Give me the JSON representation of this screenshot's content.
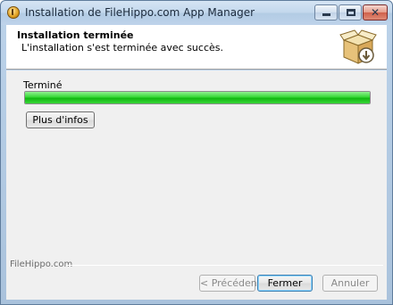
{
  "window": {
    "title": "Installation de FileHippo.com App Manager",
    "close_glyph": "✕"
  },
  "header": {
    "title": "Installation terminée",
    "subtitle": "L'installation s'est terminée avec succès.",
    "icon": "box-install-icon"
  },
  "progress": {
    "label": "Terminé",
    "value": 1.0,
    "color": "#1fc41f"
  },
  "buttons": {
    "more_info": "Plus d'infos",
    "previous": "< Précédent",
    "close": "Fermer",
    "cancel": "Annuler"
  },
  "footer": {
    "brand": "FileHippo.com"
  }
}
